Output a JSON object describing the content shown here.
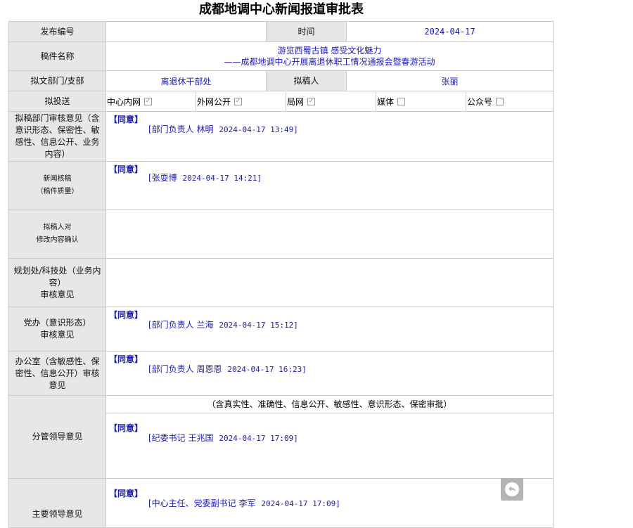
{
  "title": "成都地调中心新闻报道审批表",
  "fields": {
    "release_no_label": "发布编号",
    "release_no_value": "",
    "time_label": "时间",
    "time_value": "2024-04-17",
    "manuscript_label": "稿件名称",
    "manuscript_line1": "游览西蜀古镇 感受文化魅力",
    "manuscript_line2": "——成都地调中心开展离退休职工情况通报会暨春游活动",
    "dept_label": "拟文部门/支部",
    "dept_value": "离退休干部处",
    "author_label": "拟稿人",
    "author_value": "张丽"
  },
  "publish": {
    "label": "拟投送",
    "options": [
      {
        "label": "中心内网",
        "checked": true
      },
      {
        "label": "外网公开",
        "checked": true
      },
      {
        "label": "局网",
        "checked": true
      },
      {
        "label": "媒体",
        "checked": false
      },
      {
        "label": "公众号",
        "checked": false
      }
    ]
  },
  "reviews": [
    {
      "label": "拟稿部门审核意见（含意识形态、保密性、敏感性、信息公开、业务内容）",
      "agree": "【同意】",
      "signer": "[部门负责人 林明",
      "time": "2024-04-17 13:49]"
    },
    {
      "label_line1": "新闻核稿",
      "label_line2": "（稿件质量）",
      "agree": "【同意】",
      "signer": "[张耍博",
      "time": "2024-04-17 14:21]"
    },
    {
      "label_line1": "拟稿人对",
      "label_line2": "修改内容确认"
    },
    {
      "label_line1": "规划处/科技处（业务内容）",
      "label_line2": "审核意见"
    },
    {
      "label_line1": "党办（意识形态）",
      "label_line2": "审核意见",
      "agree": "【同意】",
      "signer": "[部门负责人 兰海",
      "time": "2024-04-17 15:12]"
    },
    {
      "label": "办公室（含敏感性、保密性、信息公开）审核意见",
      "agree": "【同意】",
      "signer": "[部门负责人 周恩恩",
      "time": "2024-04-17 16:23]"
    },
    {
      "label": "分管领导意见",
      "note": "（含真实性、准确性、信息公开、敏感性、意识形态、保密审批）",
      "agree": "【同意】",
      "signer": "[纪委书记 王兆国",
      "time": "2024-04-17 17:09]"
    },
    {
      "label": "主要领导意见",
      "agree": "【同意】",
      "signer": "[中心主任、党委副书记 李军",
      "time": "2024-04-17 17:09]"
    }
  ],
  "icons": {
    "checkbox_checked": "checkmark",
    "reply": "reply-arrow-icon"
  },
  "colors": {
    "label_bg": "#e7e7e7",
    "value_text": "#1a1ab0",
    "border": "#c9c9c9"
  }
}
